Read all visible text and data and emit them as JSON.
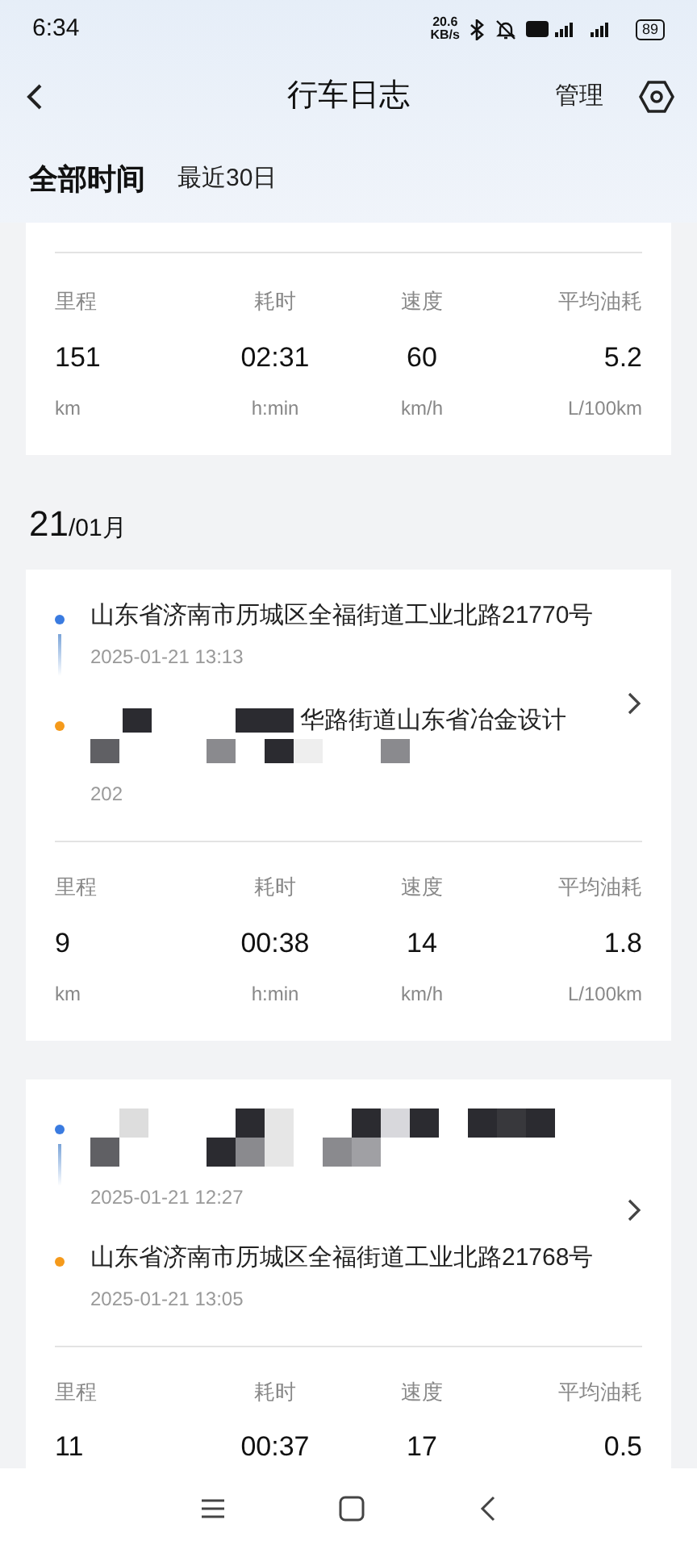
{
  "status_bar": {
    "time": "6:34",
    "net_speed": "20.6",
    "net_unit": "KB/s",
    "battery": "89"
  },
  "header": {
    "title": "行车日志",
    "action": "管理"
  },
  "filters": [
    {
      "label": "全部时间",
      "selected": true
    },
    {
      "label": "最近30日",
      "selected": false
    }
  ],
  "summary": {
    "stats": [
      {
        "label": "里程",
        "value": "151",
        "unit": "km"
      },
      {
        "label": "耗时",
        "value": "02:31",
        "unit": "h:min"
      },
      {
        "label": "速度",
        "value": "60",
        "unit": "km/h"
      },
      {
        "label": "平均油耗",
        "value": "5.2",
        "unit": "L/100km"
      }
    ]
  },
  "date_header": {
    "day": "21",
    "month": "/01月"
  },
  "trips": [
    {
      "points": [
        {
          "kind": "start",
          "address": "山东省济南市历城区全福街道工业北路21770号",
          "time": "2025-01-21 13:13",
          "redacted": false
        },
        {
          "kind": "end",
          "address": "华路街道山东省冶金设计",
          "time": "202",
          "redacted": true
        }
      ],
      "stats": [
        {
          "label": "里程",
          "value": "9",
          "unit": "km"
        },
        {
          "label": "耗时",
          "value": "00:38",
          "unit": "h:min"
        },
        {
          "label": "速度",
          "value": "14",
          "unit": "km/h"
        },
        {
          "label": "平均油耗",
          "value": "1.8",
          "unit": "L/100km"
        }
      ]
    },
    {
      "points": [
        {
          "kind": "start",
          "time": "2025-01-21 12:27",
          "redacted": true
        },
        {
          "kind": "end",
          "address": "山东省济南市历城区全福街道工业北路21768号",
          "time": "2025-01-21 13:05",
          "redacted": false
        }
      ],
      "stats": [
        {
          "label": "里程",
          "value": "11"
        },
        {
          "label": "耗时",
          "value": "00:37"
        },
        {
          "label": "速度",
          "value": "17"
        },
        {
          "label": "平均油耗",
          "value": "0.5"
        }
      ]
    }
  ]
}
